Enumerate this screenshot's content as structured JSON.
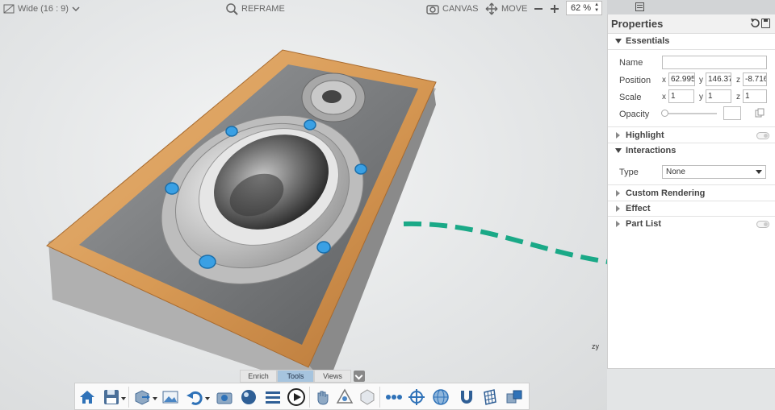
{
  "topbar": {
    "aspect_label": "Wide (16 : 9)",
    "reframe_label": "REFRAME",
    "canvas_label": "CANVAS",
    "move_label": "MOVE",
    "zoom_value": "62 %"
  },
  "panel": {
    "title": "Properties",
    "sections": {
      "essentials": "Essentials",
      "highlight": "Highlight",
      "interactions": "Interactions",
      "custom_rendering": "Custom Rendering",
      "effect": "Effect",
      "part_list": "Part List"
    },
    "fields": {
      "name_label": "Name",
      "name_value": "",
      "position_label": "Position",
      "position": {
        "x": "62.995",
        "y": "146.37",
        "z": "-8.7160"
      },
      "scale_label": "Scale",
      "scale": {
        "x": "1",
        "y": "1",
        "z": "1"
      },
      "opacity_label": "Opacity",
      "opacity_value": "",
      "type_label": "Type",
      "type_value": "None"
    },
    "axis_letters": {
      "x": "x",
      "y": "y",
      "z": "z"
    }
  },
  "tabs": [
    "Enrich",
    "Tools",
    "Views"
  ],
  "active_tab": "Tools",
  "toolbar_icons": [
    "home-icon",
    "save-icon",
    "export-icon",
    "image-icon",
    "undo-icon",
    "camera-icon",
    "render-icon",
    "list-icon",
    "play-icon",
    "hand-icon",
    "explode-icon",
    "cube-icon",
    "connect-icon",
    "target-icon",
    "globe-icon",
    "magnet-icon",
    "grid-icon",
    "parts-icon"
  ],
  "colors": {
    "accent": "#a6c4de",
    "arrow": "#1aa987",
    "handles": "#2b8fd4"
  },
  "gizmo": {
    "y": "y",
    "z": "z"
  }
}
